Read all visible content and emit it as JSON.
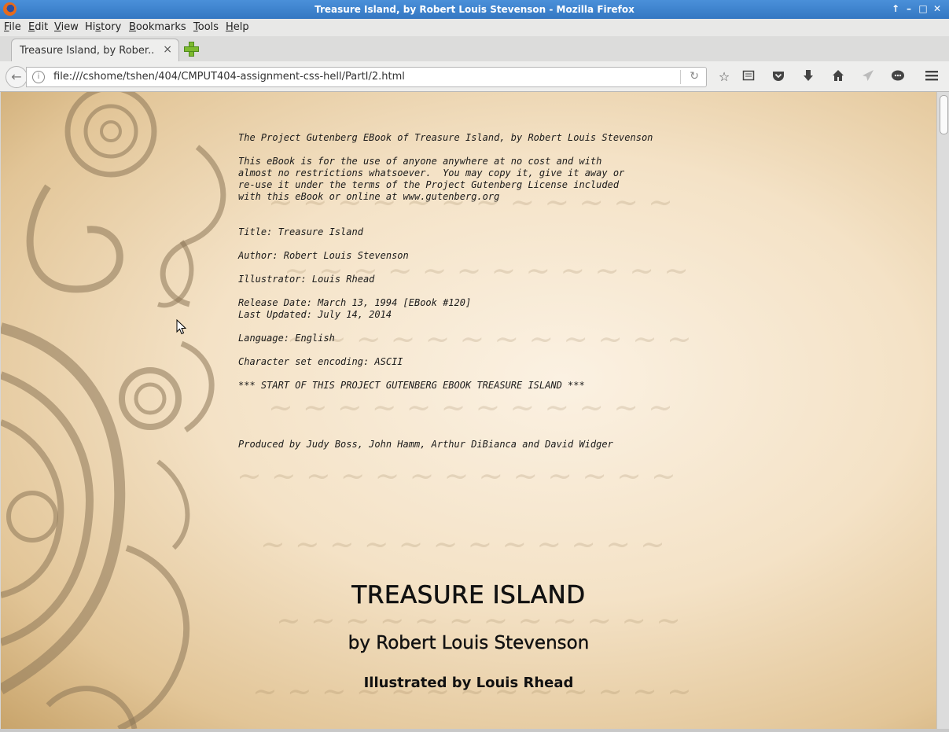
{
  "window": {
    "title": "Treasure Island, by Robert Louis Stevenson - Mozilla Firefox",
    "controls": [
      "↑",
      "–",
      "□",
      "✕"
    ]
  },
  "menu": {
    "items": [
      {
        "accel": "F",
        "rest": "ile"
      },
      {
        "accel": "E",
        "rest": "dit"
      },
      {
        "accel": "V",
        "rest": "iew"
      },
      {
        "accel": "",
        "pre": "Hi",
        "accel2": "s",
        "rest": "tory"
      },
      {
        "accel": "B",
        "rest": "ookmarks"
      },
      {
        "accel": "T",
        "rest": "ools"
      },
      {
        "accel": "H",
        "rest": "elp"
      }
    ]
  },
  "tabs": [
    {
      "label": "Treasure Island, by Rober...",
      "close": "×"
    }
  ],
  "navbar": {
    "url": "file:///cshome/tshen/404/CMPUT404-assignment-css-hell/PartI/2.html",
    "icons": [
      "bookmark-star-icon",
      "reading-list-icon",
      "pocket-icon",
      "downloads-icon",
      "home-icon",
      "share-icon",
      "chat-icon",
      "hamburger-menu-icon"
    ]
  },
  "page": {
    "gutenberg_text": "The Project Gutenberg EBook of Treasure Island, by Robert Louis Stevenson\n\nThis eBook is for the use of anyone anywhere at no cost and with\nalmost no restrictions whatsoever.  You may copy it, give it away or\nre-use it under the terms of the Project Gutenberg License included\nwith this eBook or online at www.gutenberg.org\n\n\nTitle: Treasure Island\n\nAuthor: Robert Louis Stevenson\n\nIllustrator: Louis Rhead\n\nRelease Date: March 13, 1994 [EBook #120]\nLast Updated: July 14, 2014\n\nLanguage: English\n\nCharacter set encoding: ASCII\n\n*** START OF THIS PROJECT GUTENBERG EBOOK TREASURE ISLAND ***\n\n\n\n\nProduced by Judy Boss, John Hamm, Arthur DiBianca and David Widger",
    "book_title": "TREASURE ISLAND",
    "byline": "by Robert Louis Stevenson",
    "illustrated": "Illustrated by Louis Rhead"
  }
}
